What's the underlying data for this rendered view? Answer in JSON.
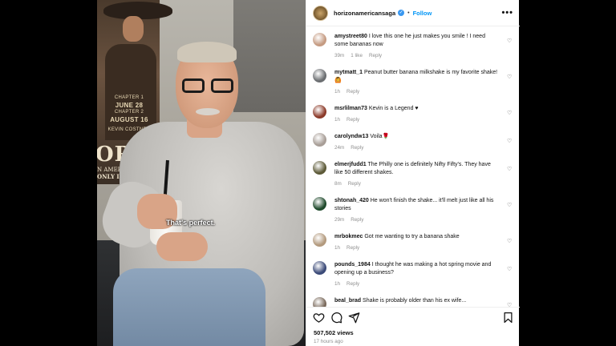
{
  "media": {
    "poster_dates": [
      "CHAPTER 1",
      "JUNE 28",
      "CHAPTER 2",
      "AUGUST 16"
    ],
    "poster_title": "ORIZ",
    "poster_subtitle": "N AMERICA",
    "poster_only": "ONLY IN TH",
    "poster_actor": "KEVIN COSTNER",
    "caption": "That's perfect."
  },
  "header": {
    "account": "horizonamericansaga",
    "separator": "•",
    "follow_label": "Follow",
    "more_icon": "more-horizontal-icon"
  },
  "comments": [
    {
      "user": "amystreet80",
      "text": "I love this one he just makes you smile ! I need some bananas now",
      "time": "39m",
      "likes": "1 like",
      "reply": "Reply",
      "avatar_color": "#c59b82"
    },
    {
      "user": "mytmatt_1",
      "text": "Peanut butter banana milkshake is my favorite shake!🙆",
      "time": "1h",
      "likes": "",
      "reply": "Reply",
      "avatar_color": "#6b6e71"
    },
    {
      "user": "msrlilman73",
      "text": "Kevin is a Legend ♥",
      "time": "1h",
      "likes": "",
      "reply": "Reply",
      "avatar_color": "#8c3b2a"
    },
    {
      "user": "carolyndw13",
      "text": "Voila🌹",
      "time": "24m",
      "likes": "",
      "reply": "Reply",
      "avatar_color": "#a89e97"
    },
    {
      "user": "elmerjfudd1",
      "text": "The Philly one is definitely Nifty Fifty's. They have like 50 different shakes.",
      "time": "8m",
      "likes": "",
      "reply": "Reply",
      "avatar_color": "#5d5a38"
    },
    {
      "user": "shtonah_420",
      "text": "He won't finish the shake... it'll melt just like all his stories",
      "time": "29m",
      "likes": "",
      "reply": "Reply",
      "avatar_color": "#1f4a2c"
    },
    {
      "user": "mrbokmec",
      "text": "Got me wanting to try a banana shake",
      "time": "1h",
      "likes": "",
      "reply": "Reply",
      "avatar_color": "#b39a7e"
    },
    {
      "user": "pounds_1984",
      "text": "I thought he was making a hot spring movie and opening up a business?",
      "time": "1h",
      "likes": "",
      "reply": "Reply",
      "avatar_color": "#3b4a78"
    },
    {
      "user": "beal_brad",
      "text": "Shake is probably older than his ex wife...",
      "time": "",
      "likes": "",
      "reply": "",
      "avatar_color": "#7a6a5c"
    }
  ],
  "actions": {
    "icons": [
      "heart-icon",
      "comment-icon",
      "share-icon",
      "bookmark-icon"
    ],
    "views": "507,502 views",
    "time": "17 hours ago"
  },
  "colors": {
    "link": "#0095f6",
    "muted": "#8e8e8e",
    "verified": "#3897f0"
  }
}
